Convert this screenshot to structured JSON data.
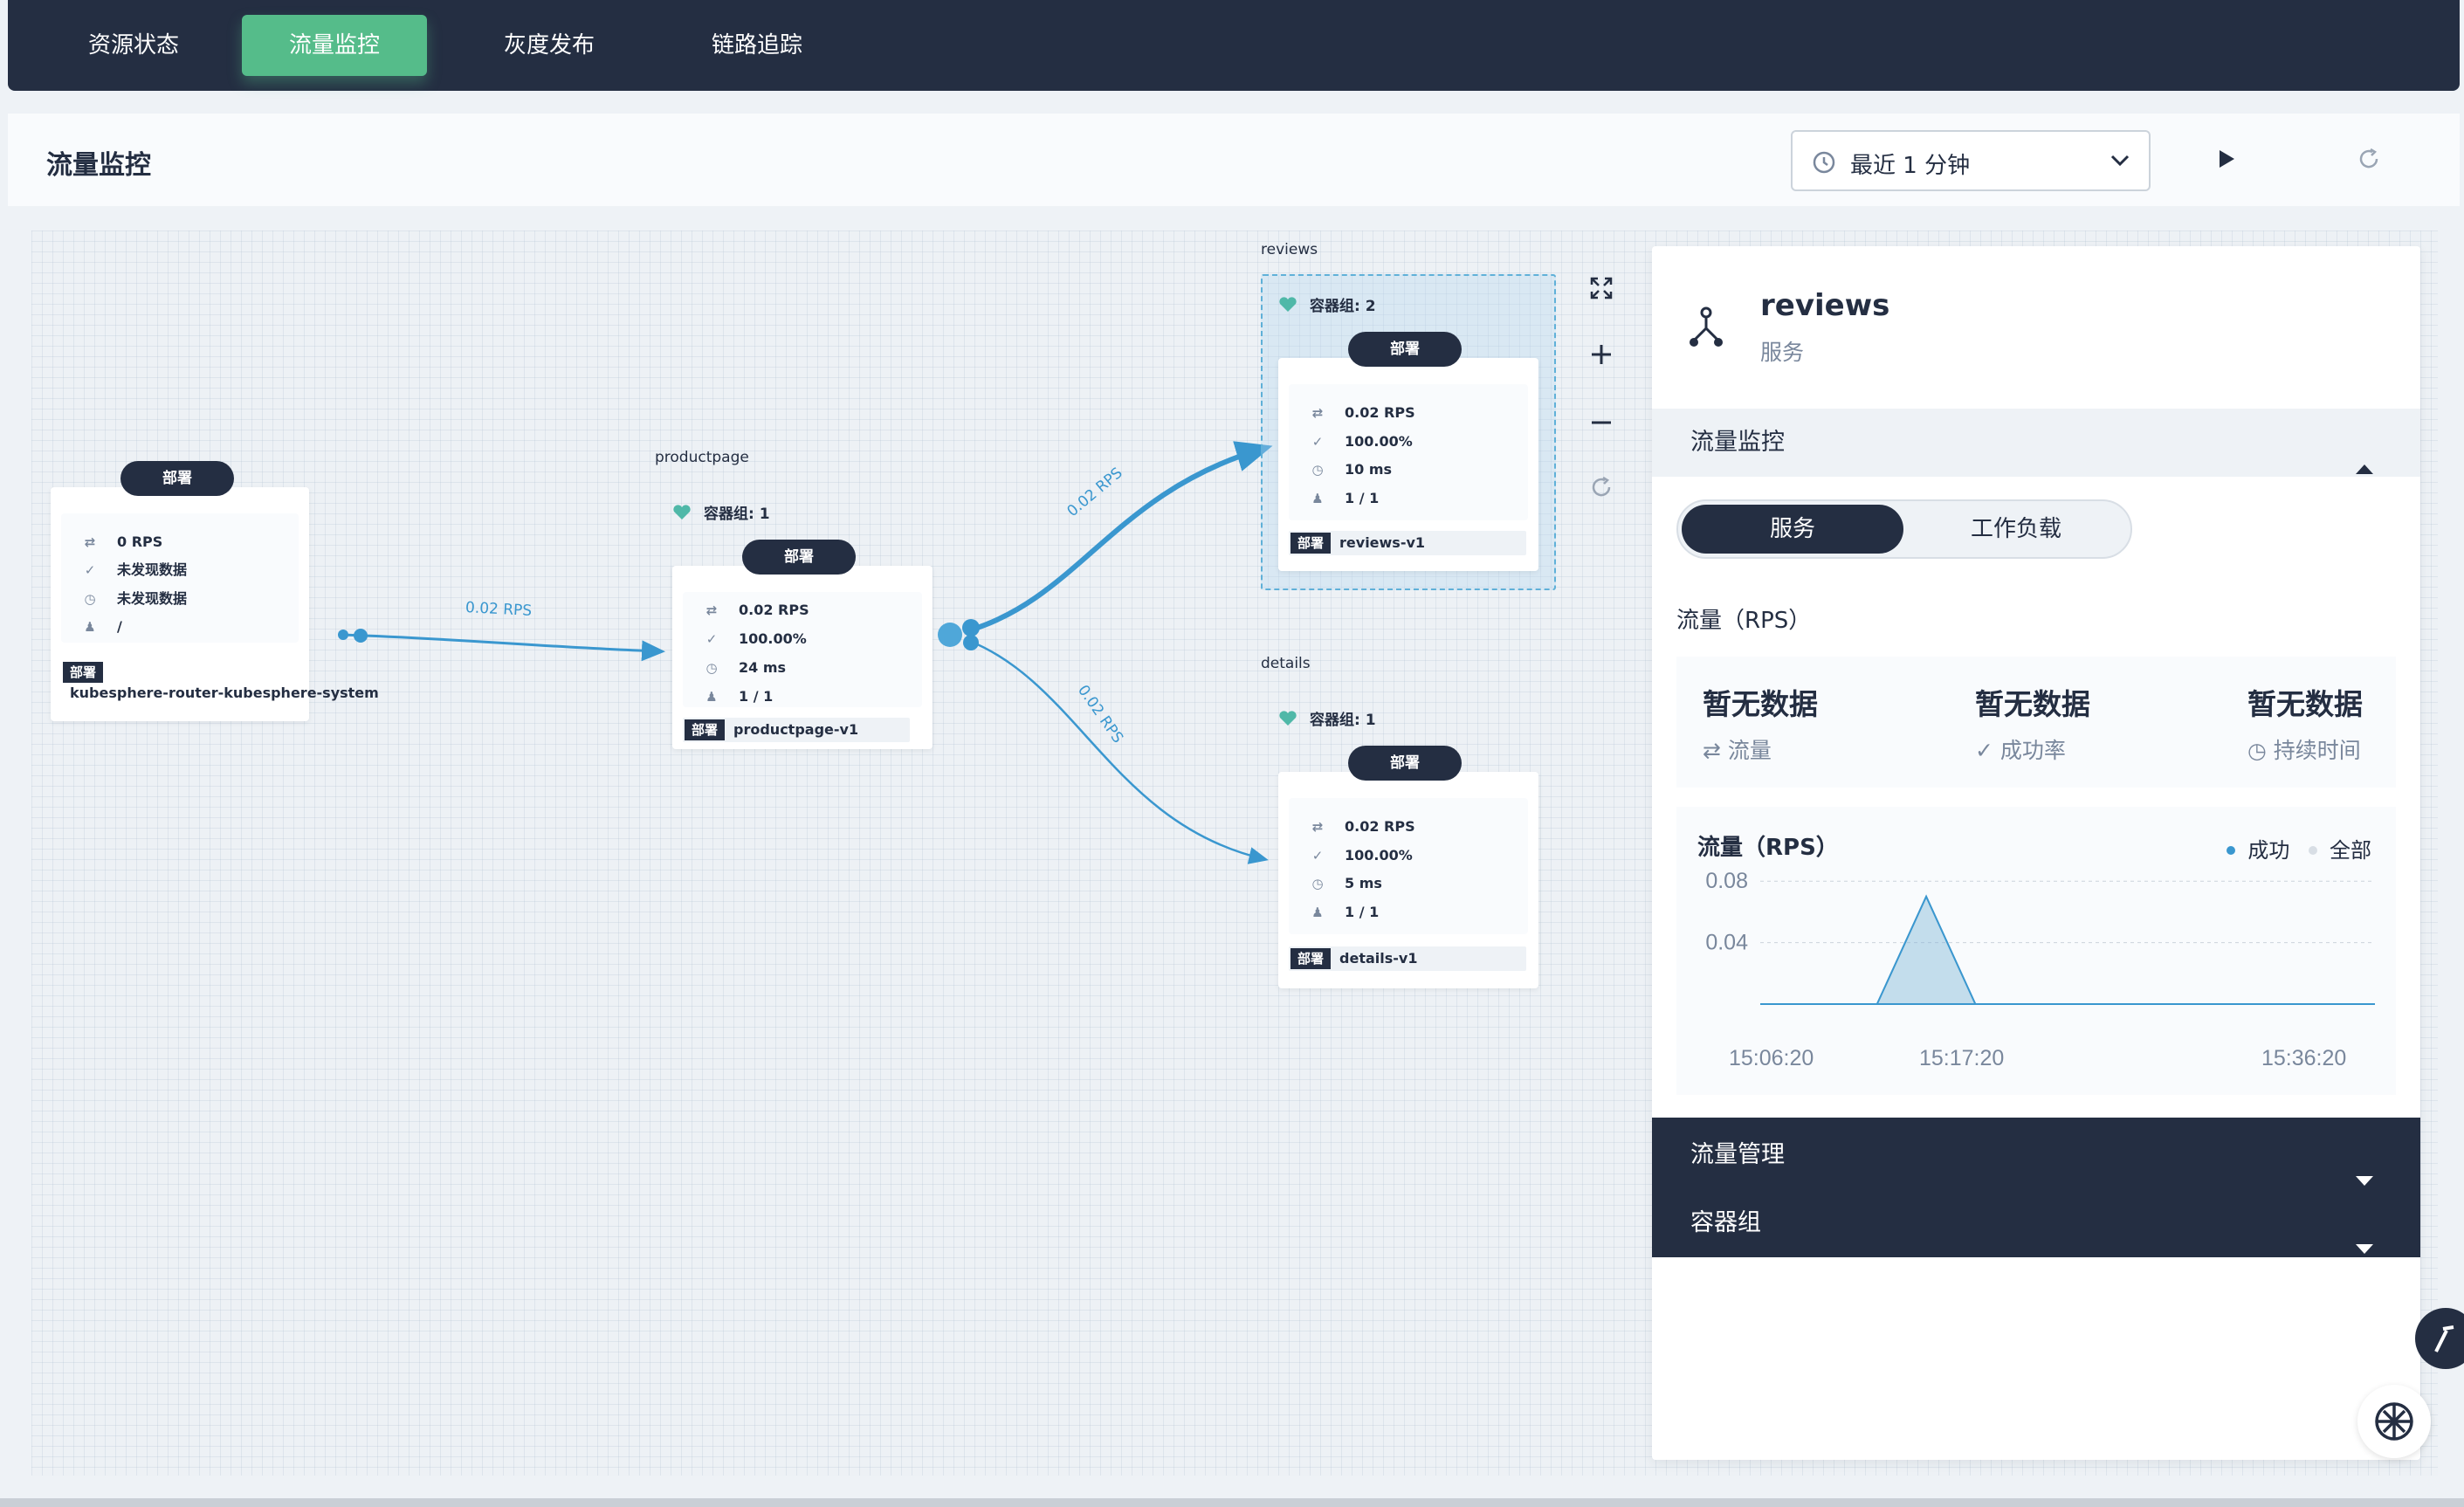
{
  "tabs": [
    {
      "label": "资源状态"
    },
    {
      "label": "流量监控"
    },
    {
      "label": "灰度发布"
    },
    {
      "label": "链路追踪"
    }
  ],
  "header": {
    "title": "流量监控",
    "time_range": "最近 1 分钟"
  },
  "topology": {
    "router": {
      "pill": "部署",
      "rps": "0 RPS",
      "success": "未发现数据",
      "duration": "未发现数据",
      "replicas": "/",
      "dep_tag": "部署",
      "name": "kubesphere-router-kubesphere-system"
    },
    "productpage": {
      "group": "productpage",
      "pods": "容器组: 1",
      "pill": "部署",
      "rps": "0.02 RPS",
      "success": "100.00%",
      "duration": "24 ms",
      "replicas": "1 / 1",
      "dep_tag": "部署",
      "name": "productpage-v1"
    },
    "reviews": {
      "group": "reviews",
      "pods": "容器组: 2",
      "pill": "部署",
      "rps": "0.02 RPS",
      "success": "100.00%",
      "duration": "10 ms",
      "replicas": "1 / 1",
      "dep_tag": "部署",
      "name": "reviews-v1"
    },
    "details": {
      "group": "details",
      "pods": "容器组: 1",
      "pill": "部署",
      "rps": "0.02 RPS",
      "success": "100.00%",
      "duration": "5 ms",
      "replicas": "1 / 1",
      "dep_tag": "部署",
      "name": "details-v1"
    },
    "edges": [
      {
        "label": "0.02 RPS"
      },
      {
        "label": "0.02 RPS"
      },
      {
        "label": "0.02 RPS"
      }
    ]
  },
  "panel": {
    "title": "reviews",
    "subtitle": "服务",
    "section_traffic": "流量监控",
    "seg_service": "服务",
    "seg_workload": "工作负载",
    "rps_title": "流量（RPS）",
    "metrics": [
      {
        "value": "暂无数据",
        "label": "流量"
      },
      {
        "value": "暂无数据",
        "label": "成功率"
      },
      {
        "value": "暂无数据",
        "label": "持续时间"
      }
    ],
    "chart_title": "流量（RPS）",
    "legend_success": "成功",
    "legend_all": "全部",
    "section_mgmt": "流量管理",
    "section_pods": "容器组"
  },
  "chart_data": {
    "type": "area",
    "title": "流量（RPS）",
    "x_ticks": [
      "15:06:20",
      "15:17:20",
      "15:36:20"
    ],
    "y_ticks": [
      "0.08",
      "0.04"
    ],
    "ylim": [
      0,
      0.1
    ],
    "series": [
      {
        "name": "成功",
        "color": "#3a97cf",
        "points": [
          [
            0,
            0
          ],
          [
            0.19,
            0
          ],
          [
            0.27,
            0.07
          ],
          [
            0.35,
            0
          ],
          [
            1,
            0
          ]
        ]
      },
      {
        "name": "全部",
        "color": "#d8dee5",
        "points": [
          [
            0,
            0
          ],
          [
            0.19,
            0
          ],
          [
            0.27,
            0.07
          ],
          [
            0.35,
            0
          ],
          [
            1,
            0
          ]
        ]
      }
    ]
  },
  "colors": {
    "dark": "#242e42",
    "accent": "#55bc8a",
    "edge": "#3a97cf"
  }
}
